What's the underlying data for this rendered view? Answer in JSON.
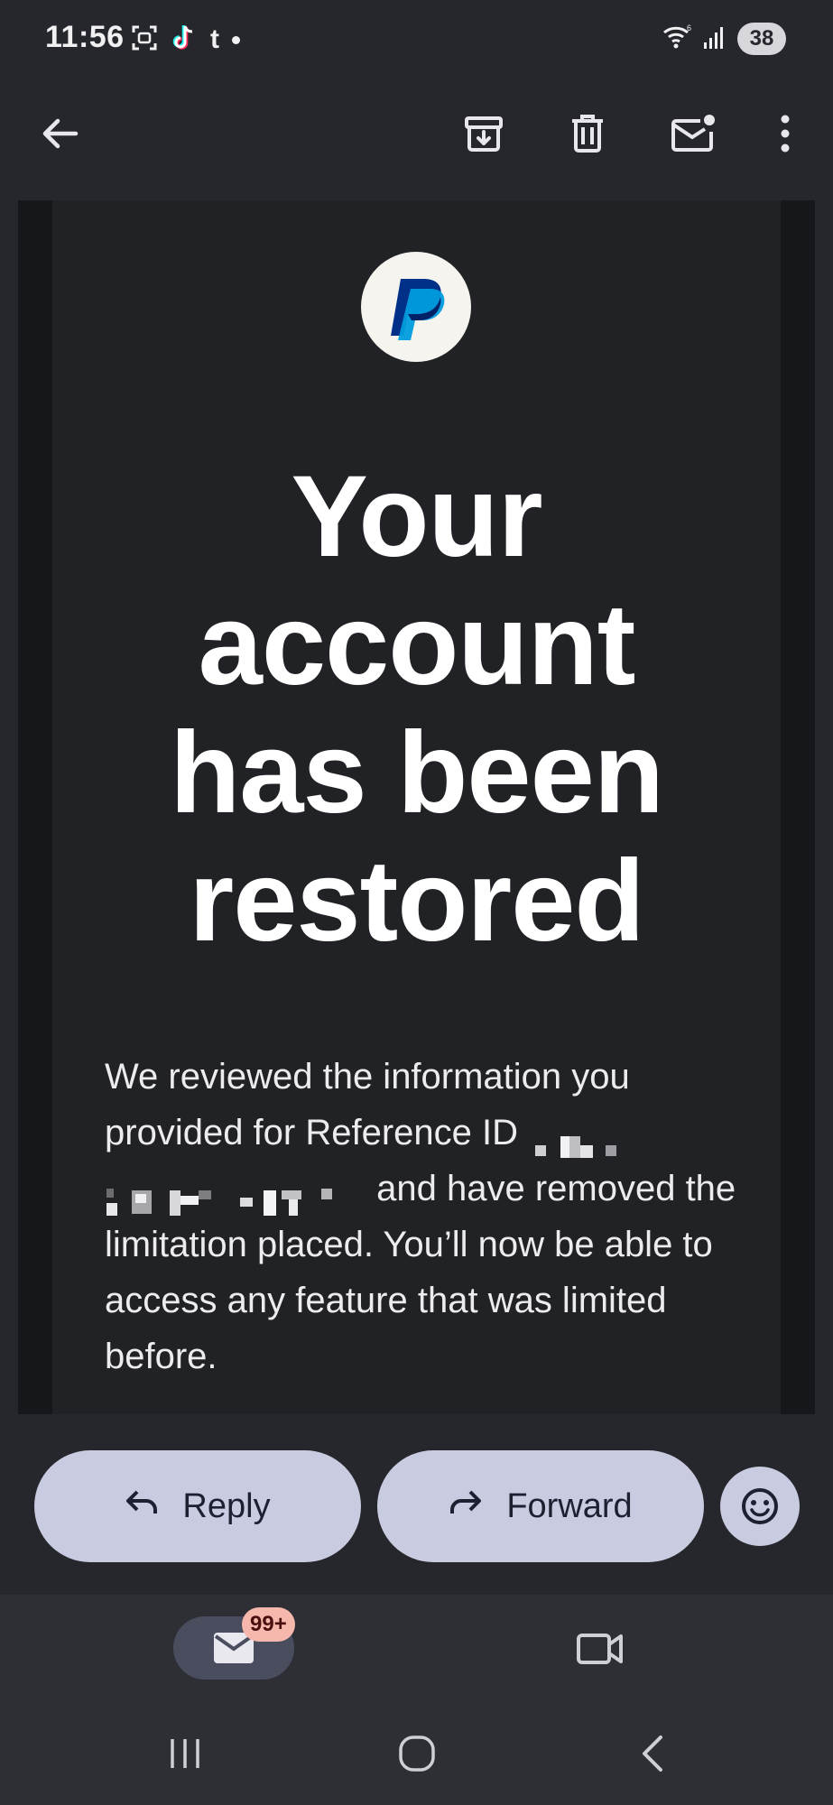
{
  "status_bar": {
    "time": "11:56",
    "notification_icons": [
      "screenshot-icon",
      "tiktok-icon",
      "tumblr-icon",
      "more-dot-icon"
    ],
    "tumblr_glyph": "t",
    "battery": "38"
  },
  "toolbar": {
    "icons": [
      "back-arrow-icon",
      "archive-icon",
      "delete-icon",
      "mark-unread-icon",
      "more-vert-icon"
    ]
  },
  "email": {
    "headline_lines": [
      "Your",
      "account",
      "has been",
      "restored"
    ],
    "body_segments": {
      "part1": "We reviewed the information you provided for Reference ID",
      "part2": "and have removed the limitation placed. You’ll now be able to access any feature that was limited before."
    }
  },
  "actions": {
    "reply_label": "Reply",
    "forward_label": "Forward"
  },
  "bottom_nav": {
    "mail_badge": "99+"
  },
  "colors": {
    "background": "#26272c",
    "email_bg": "#212226",
    "button_bg": "#c9cce0",
    "badge_bg": "#f6b7ad",
    "paypal_dark": "#003087",
    "paypal_light": "#009cde"
  }
}
